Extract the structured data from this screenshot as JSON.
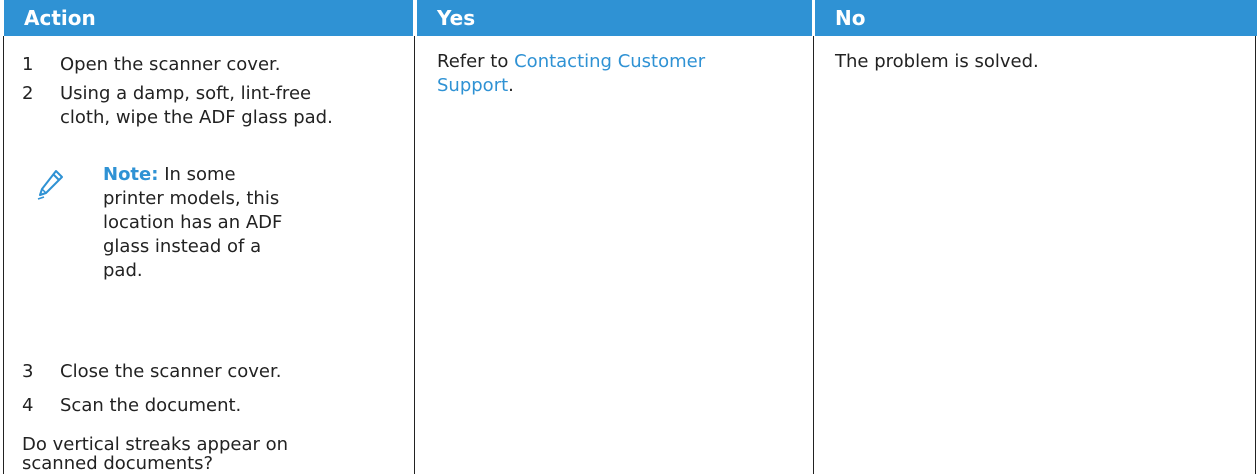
{
  "table": {
    "headers": [
      "Action",
      "Yes",
      "No"
    ],
    "action": {
      "steps": [
        {
          "num": "1",
          "text": "Open the scanner cover."
        },
        {
          "num": "2",
          "text": "Using a damp, soft, lint-free cloth, wipe the ADF glass pad."
        },
        {
          "num": "3",
          "text": "Close the scanner cover."
        },
        {
          "num": "4",
          "text": "Scan the document."
        }
      ],
      "note": {
        "label": "Note:",
        "text": "In some printer models, this location has an ADF glass instead of a pad."
      },
      "question": "Do vertical streaks appear on scanned documents?"
    },
    "yes": {
      "prefix": "Refer to ",
      "link": "Contacting Customer Support",
      "suffix": "."
    },
    "no": {
      "text": "The problem is solved."
    }
  },
  "colors": {
    "header": "#2f92d4",
    "link": "#2f92d4"
  },
  "icons": {
    "note": "pencil-icon"
  }
}
